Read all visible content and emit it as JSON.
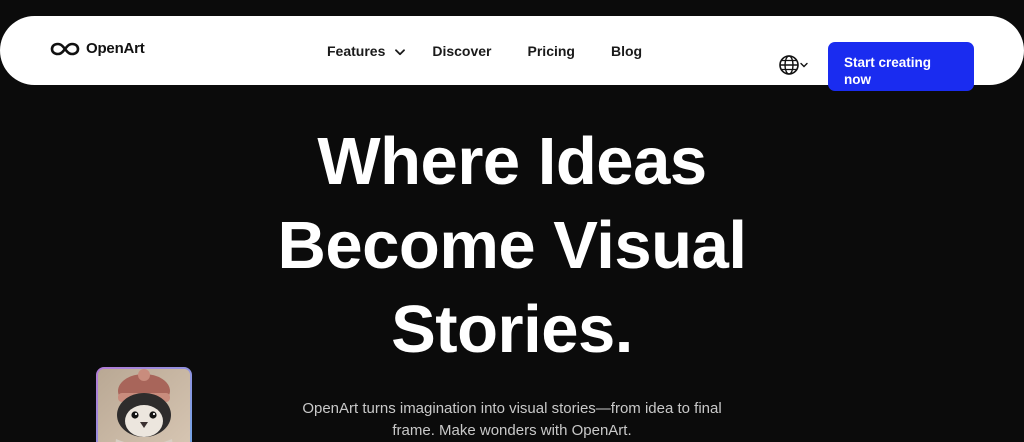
{
  "header": {
    "logo_text": "OpenArt",
    "nav": {
      "features": "Features",
      "discover": "Discover",
      "pricing": "Pricing",
      "blog": "Blog"
    },
    "cta_line1": "Start creating",
    "cta_line2": "now"
  },
  "hero": {
    "title_line1": "Where Ideas",
    "title_line2": "Become Visual",
    "title_line3": "Stories.",
    "subtitle_line1": "OpenArt turns imagination into visual stories—from idea to final",
    "subtitle_line2": "frame. Make wonders with OpenArt."
  },
  "colors": {
    "page_bg": "#0b0b0b",
    "nav_bg": "#ffffff",
    "cta_bg": "#1a2cf0",
    "text_light": "#ffffff",
    "text_muted": "#c9c9c9"
  },
  "icons": {
    "logo": "infinity-logo-icon",
    "features_dropdown": "chevron-down-icon",
    "language": "globe-icon",
    "thumbnail": "penguin-image"
  }
}
